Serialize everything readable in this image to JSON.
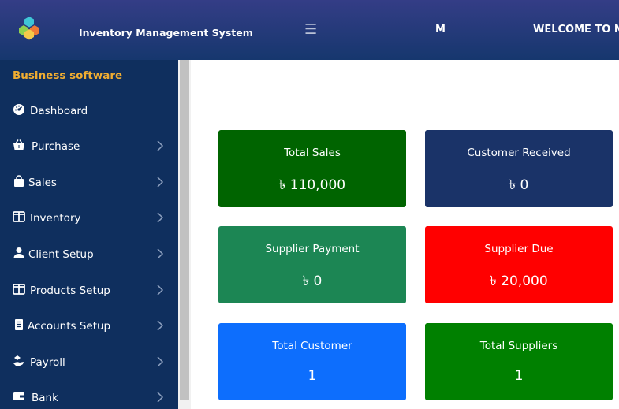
{
  "header": {
    "app_title": "Inventory Management System",
    "menu_icon": "hamburger-icon",
    "user_initial": "M",
    "welcome_text": "WELCOME TO MY"
  },
  "sidebar": {
    "brand": "Business software",
    "items": [
      {
        "label": "Dashboard",
        "icon": "dashboard-icon",
        "has_submenu": false
      },
      {
        "label": "Purchase",
        "icon": "basket-icon",
        "has_submenu": true
      },
      {
        "label": "Sales",
        "icon": "shopping-bag-icon",
        "has_submenu": true
      },
      {
        "label": "Inventory",
        "icon": "columns-icon",
        "has_submenu": true
      },
      {
        "label": "Client Setup",
        "icon": "user-icon",
        "has_submenu": true
      },
      {
        "label": "Products Setup",
        "icon": "columns-icon",
        "has_submenu": true
      },
      {
        "label": "Accounts Setup",
        "icon": "ledger-icon",
        "has_submenu": true
      },
      {
        "label": "Payroll",
        "icon": "hand-money-icon",
        "has_submenu": true
      },
      {
        "label": "Bank",
        "icon": "wallet-icon",
        "has_submenu": true
      }
    ]
  },
  "cards": [
    {
      "label": "Total Sales",
      "value": "৳ 110,000",
      "color": "#006400"
    },
    {
      "label": "Customer Received",
      "value": "৳ 0",
      "color": "#1a3368"
    },
    {
      "label": "Supplier Payment",
      "value": "৳ 0",
      "color": "#1c8654"
    },
    {
      "label": "Supplier Due",
      "value": "৳ 20,000",
      "color": "#ff0000"
    },
    {
      "label": "Total Customer",
      "value": "1",
      "color": "#0d6efd"
    },
    {
      "label": "Total Suppliers",
      "value": "1",
      "color": "#008000"
    }
  ],
  "colors": {
    "header_gradient_top": "#343d86",
    "header_gradient_bottom": "#16376e",
    "sidebar_bg": "#0f2f5e",
    "brand_accent": "#f0ad31"
  }
}
